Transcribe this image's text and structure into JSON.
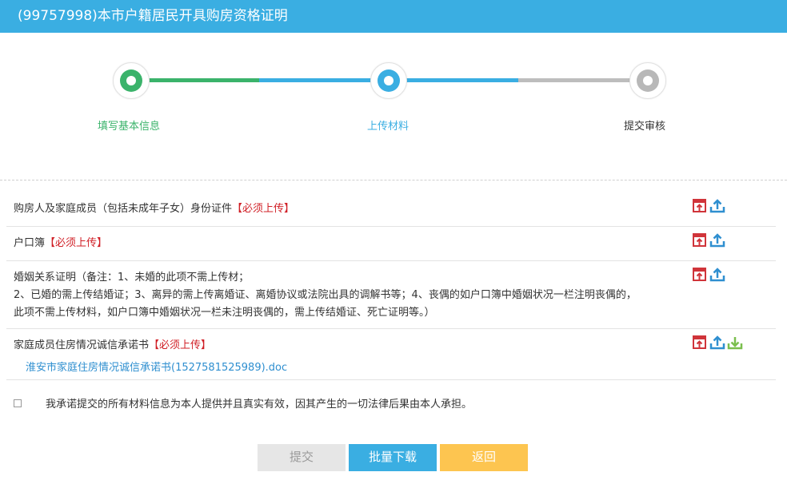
{
  "header": {
    "title": "(99757998)本市户籍居民开具购房资格证明"
  },
  "steps": [
    {
      "label": "填写基本信息",
      "status": "done"
    },
    {
      "label": "上传材料",
      "status": "current"
    },
    {
      "label": "提交审核",
      "status": "pending"
    }
  ],
  "materials": [
    {
      "desc": "购房人及家庭成员（包括未成年子女）身份证件",
      "required": "【必须上传】"
    },
    {
      "desc": "户口簿",
      "required": "【必须上传】"
    },
    {
      "desc_lines": [
        "婚姻关系证明（备注：1、未婚的此项不需上传材；",
        "2、已婚的需上传结婚证；3、离异的需上传离婚证、离婚协议或法院出具的调解书等；4、丧偶的如户口簿中婚姻状况一栏注明丧偶的，",
        "此项不需上传材料，如户口簿中婚姻状况一栏未注明丧偶的，需上传结婚证、死亡证明等。）"
      ]
    },
    {
      "desc": "家庭成员住房情况诚信承诺书",
      "required": "【必须上传】",
      "file": "淮安市家庭住房情况诚信承诺书(1527581525989).doc"
    }
  ],
  "promise": {
    "text": "我承诺提交的所有材料信息为本人提供并且真实有效，因其产生的一切法律后果由本人承担。"
  },
  "buttons": {
    "submit": "提交",
    "batch_download": "批量下载",
    "back": "返回"
  },
  "colors": {
    "header": "#3aaee2",
    "done": "#3bb36b",
    "current": "#3aaee2",
    "pending": "#b8b8b8",
    "required": "#d01f26",
    "back": "#fdc550"
  },
  "icons": [
    "template-icon",
    "upload-icon",
    "download-icon"
  ]
}
